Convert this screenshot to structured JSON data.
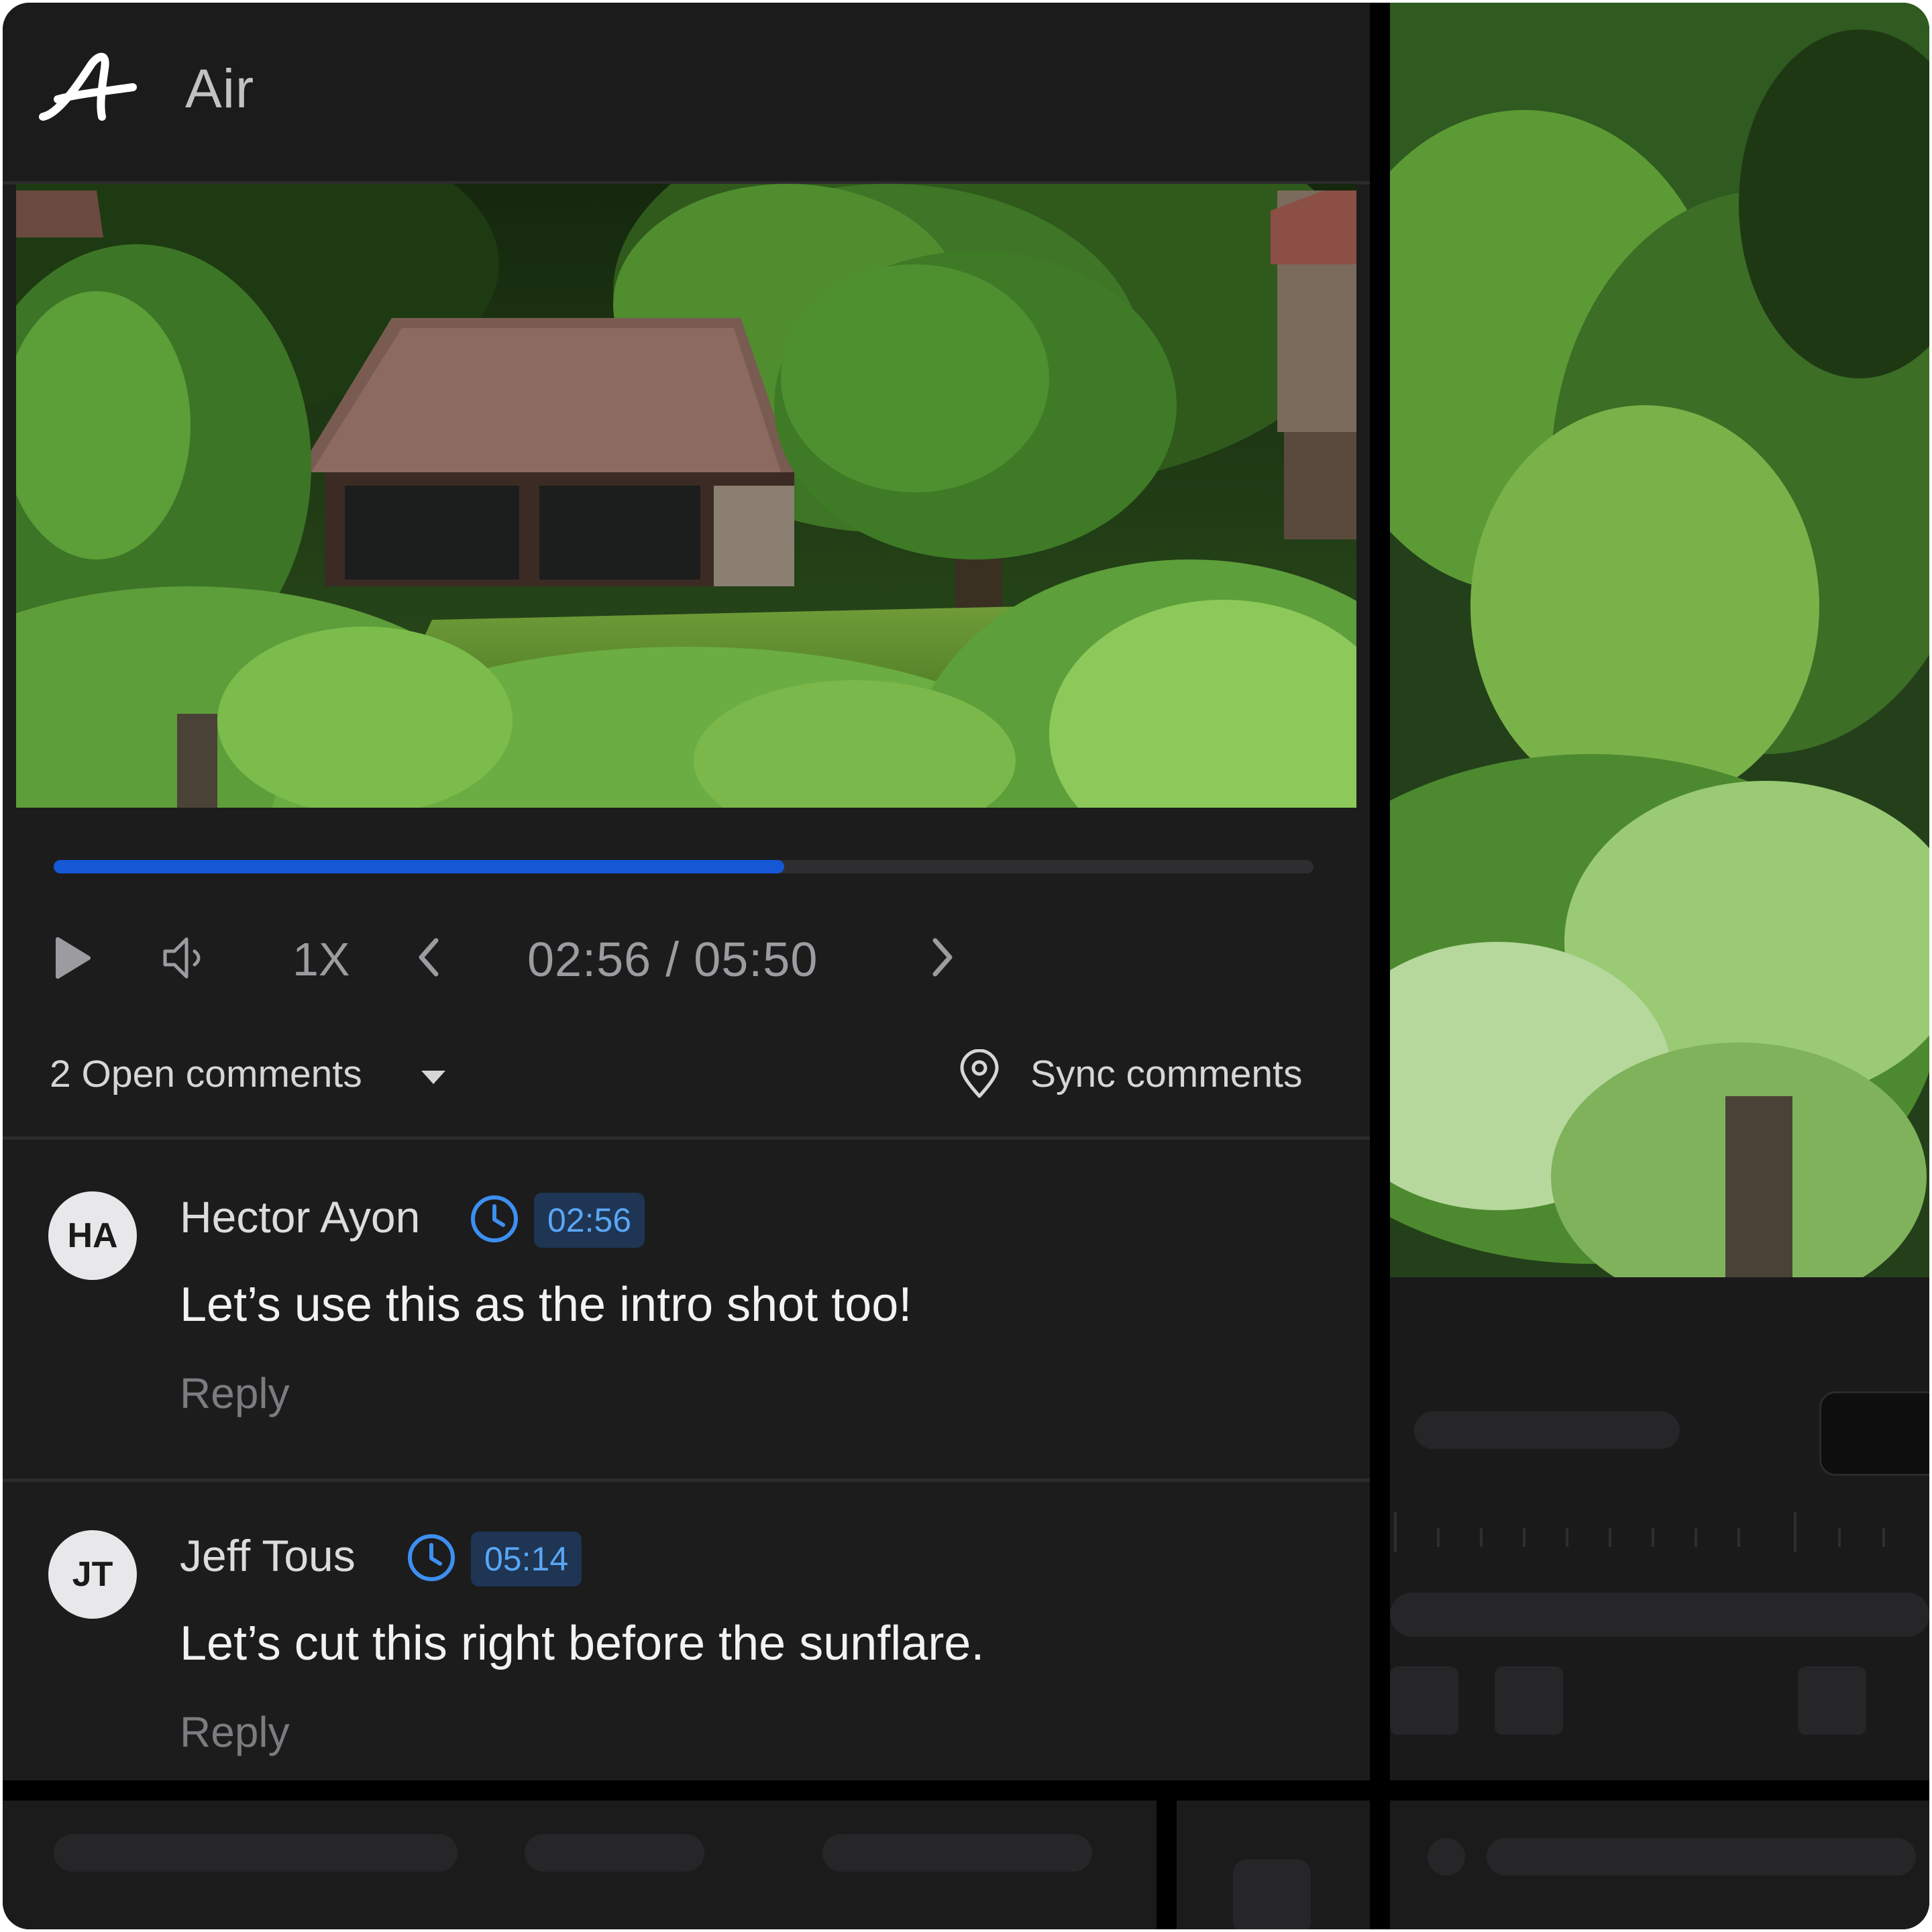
{
  "app": {
    "name": "Air"
  },
  "player": {
    "progress": 0.58,
    "speed": "1X",
    "timecode": "02:56 / 05:50"
  },
  "comments_bar": {
    "open_label": "2 Open comments",
    "sync_label": "Sync comments"
  },
  "comments": [
    {
      "initials": "HA",
      "author": "Hector Ayon",
      "timestamp": "02:56",
      "text": "Let’s use this as the intro shot too!",
      "reply": "Reply"
    },
    {
      "initials": "JT",
      "author": "Jeff Tous",
      "timestamp": "05:14",
      "text": "Let’s cut this right before the sunflare.",
      "reply": "Reply"
    }
  ],
  "icons": {
    "logo": "air-logo-icon",
    "play": "play-icon",
    "volume": "volume-icon",
    "prev": "chevron-left-icon",
    "next": "chevron-right-icon",
    "dropdown": "caret-down-icon",
    "pin": "location-pin-icon",
    "clock": "clock-icon"
  },
  "colors": {
    "panel_bg": "#1c1c1d",
    "accent_blue": "#1458d6",
    "timestamp_bg": "#1e3553",
    "timestamp_text": "#5aa6f5",
    "clock_blue": "#3d8ff0"
  }
}
